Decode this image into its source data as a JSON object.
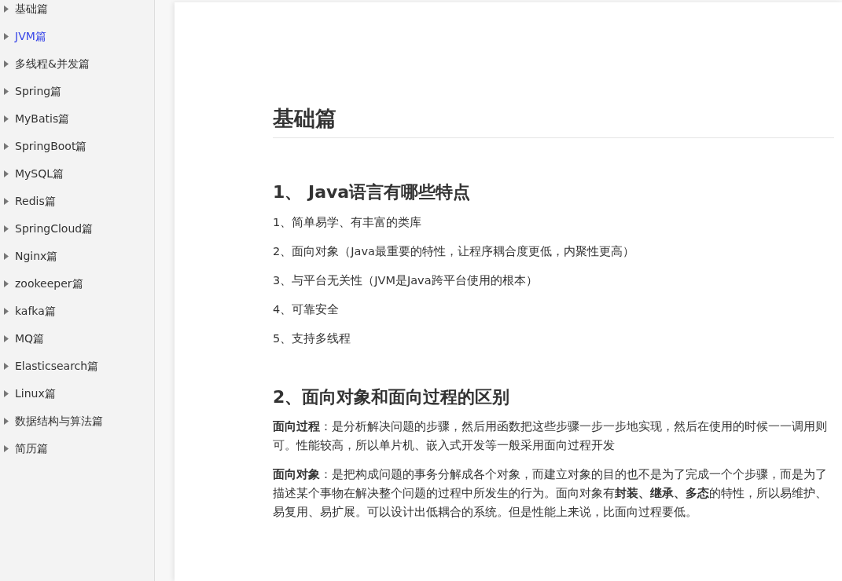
{
  "sidebar": {
    "items": [
      {
        "label": "基础篇",
        "selected": false
      },
      {
        "label": "JVM篇",
        "selected": true
      },
      {
        "label": "多线程&并发篇",
        "selected": false
      },
      {
        "label": "Spring篇",
        "selected": false
      },
      {
        "label": "MyBatis篇",
        "selected": false
      },
      {
        "label": "SpringBoot篇",
        "selected": false
      },
      {
        "label": "MySQL篇",
        "selected": false
      },
      {
        "label": "Redis篇",
        "selected": false
      },
      {
        "label": "SpringCloud篇",
        "selected": false
      },
      {
        "label": "Nginx篇",
        "selected": false
      },
      {
        "label": "zookeeper篇",
        "selected": false
      },
      {
        "label": "kafka篇",
        "selected": false
      },
      {
        "label": "MQ篇",
        "selected": false
      },
      {
        "label": "Elasticsearch篇",
        "selected": false
      },
      {
        "label": "Linux篇",
        "selected": false
      },
      {
        "label": "数据结构与算法篇",
        "selected": false
      },
      {
        "label": "简历篇",
        "selected": false
      }
    ]
  },
  "article": {
    "title": "基础篇",
    "sections": [
      {
        "heading": "1、 Java语言有哪些特点",
        "paragraphs": [
          "1、简单易学、有丰富的类库",
          "2、面向对象（Java最重要的特性，让程序耦合度更低，内聚性更高）",
          "3、与平台无关性（JVM是Java跨平台使用的根本）",
          "4、可靠安全",
          "5、支持多线程"
        ]
      },
      {
        "heading": "2、面向对象和面向过程的区别",
        "paragraphs": [
          "**面向过程**：是分析解决问题的步骤，然后用函数把这些步骤一步一步地实现，然后在使用的时候一一调用则可。性能较高，所以单片机、嵌入式开发等一般采用面向过程开发",
          "**面向对象**：是把构成问题的事务分解成各个对象，而建立对象的目的也不是为了完成一个个步骤，而是为了描述某个事物在解决整个问题的过程中所发生的行为。面向对象有**封装、继承、多态**的特性，所以易维护、易复用、易扩展。可以设计出低耦合的系统。但是性能上来说，比面向过程要低。"
        ]
      }
    ]
  }
}
